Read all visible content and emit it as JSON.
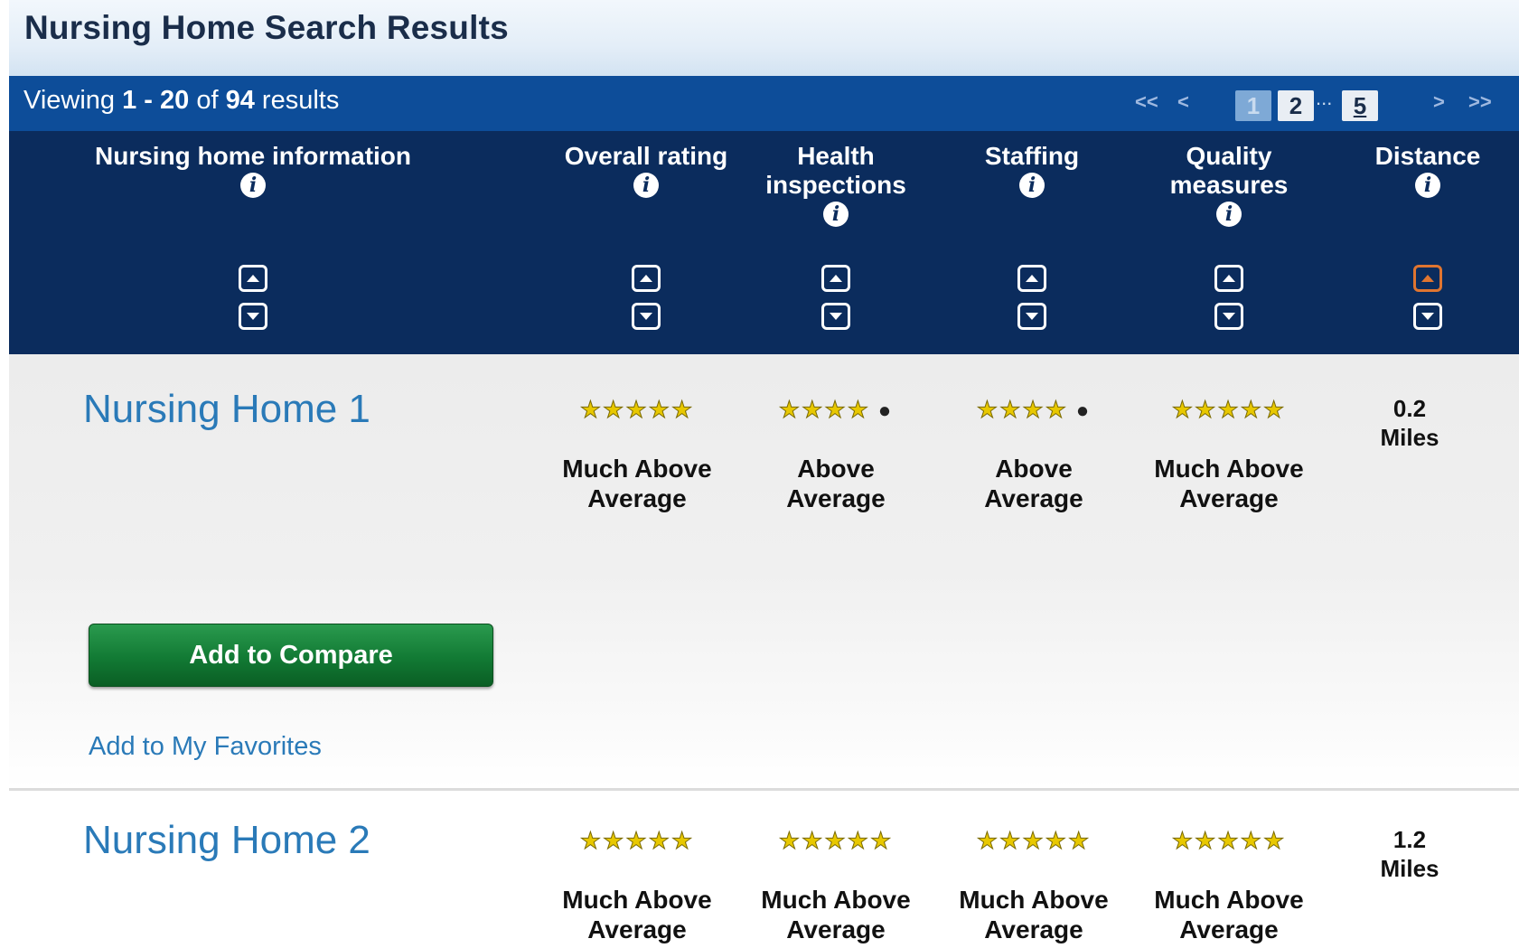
{
  "page": {
    "title": "Nursing Home Search Results"
  },
  "viewing": {
    "prefix": "Viewing",
    "range": "1 - 20",
    "of": "of",
    "total": "94",
    "suffix": "results"
  },
  "pagination": {
    "first": "<<",
    "prev": "<",
    "next": ">",
    "last": ">>",
    "pages": [
      "1",
      "2",
      "5"
    ],
    "ellipsis": "...",
    "current_page": "1"
  },
  "columns": {
    "info": "Nursing home information",
    "overall": "Overall rating",
    "health": "Health inspections",
    "staffing": "Staffing",
    "quality": "Quality measures",
    "distance": "Distance",
    "info_icon": "i",
    "active_sort": {
      "column": "distance",
      "direction": "ascending"
    }
  },
  "results": [
    {
      "name": "Nursing Home 1",
      "overall": {
        "stars": 5,
        "display": "★★★★★",
        "text": "Much Above Average"
      },
      "health": {
        "stars": 4,
        "display": "★★★★",
        "text": "Above Average"
      },
      "staffing": {
        "stars": 4,
        "display": "★★★★",
        "text": "Above Average"
      },
      "quality": {
        "stars": 5,
        "display": "★★★★★",
        "text": "Much Above Average"
      },
      "distance": "0.2 Miles",
      "compare_label": "Add to Compare",
      "favorite_label": "Add to My Favorites"
    },
    {
      "name": "Nursing Home 2",
      "overall": {
        "stars": 5,
        "display": "★★★★★",
        "text": "Much Above Average"
      },
      "health": {
        "stars": 5,
        "display": "★★★★★",
        "text": "Much Above Average"
      },
      "staffing": {
        "stars": 5,
        "display": "★★★★★",
        "text": "Much Above Average"
      },
      "quality": {
        "stars": 5,
        "display": "★★★★★",
        "text": "Much Above Average"
      },
      "distance": "1.2 Miles"
    }
  ],
  "colors": {
    "header_navy": "#0b2c5d",
    "viewing_blue": "#0d4d99",
    "link_blue": "#2a7ab8",
    "button_green": "#127a34",
    "star_gold": "#e8c800",
    "active_sort_orange": "#e07530"
  }
}
